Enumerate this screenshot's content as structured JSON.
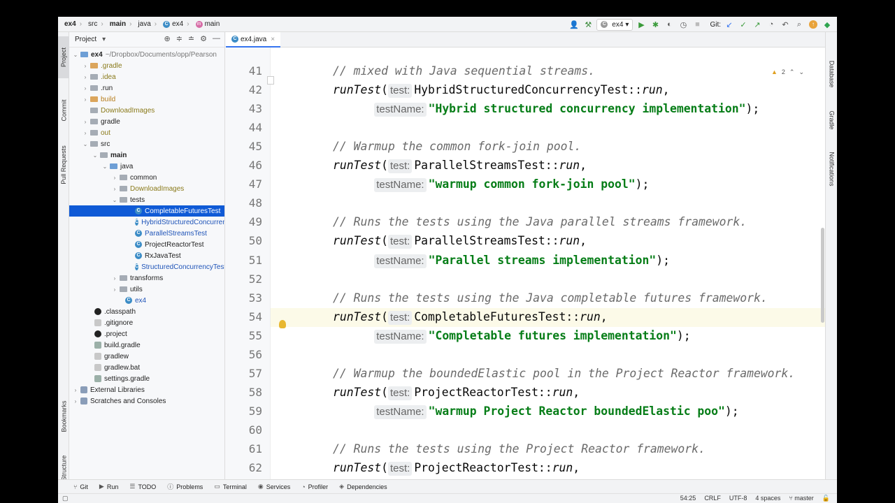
{
  "breadcrumb": [
    "ex4",
    "src",
    "main",
    "java",
    "ex4",
    "main"
  ],
  "toolbar": {
    "run_config": "ex4",
    "git_label": "Git:"
  },
  "left_strip": [
    "Project",
    "Commit",
    "Pull Requests",
    "Bookmarks",
    "Structure"
  ],
  "right_strip": [
    "Database",
    "Gradle",
    "Notifications"
  ],
  "project_panel": {
    "title": "Project",
    "root_label": "ex4",
    "root_path": "~/Dropbox/Documents/opp/Pearson",
    "items": [
      ".gradle",
      ".idea",
      ".run",
      "build",
      "DownloadImages",
      "gradle",
      "out",
      "src",
      "main",
      "java",
      "common",
      "DownloadImages",
      "tests",
      "CompletableFuturesTest",
      "HybridStructuredConcurrencyTest",
      "ParallelStreamsTest",
      "ProjectReactorTest",
      "RxJavaTest",
      "StructuredConcurrencyTest",
      "transforms",
      "utils",
      "ex4",
      ".classpath",
      ".gitignore",
      ".project",
      "build.gradle",
      "gradlew",
      "gradlew.bat",
      "settings.gradle",
      "External Libraries",
      "Scratches and Consoles"
    ]
  },
  "editor": {
    "tab": "ex4.java",
    "warnings": "2",
    "lines": [
      {
        "num": "41",
        "parts": [
          [
            "cm",
            "// mixed with Java sequential streams."
          ]
        ]
      },
      {
        "num": "42",
        "parts": [
          [
            "fn",
            "runTest"
          ],
          [
            "",
            "("
          ],
          [
            "hint",
            "test:"
          ],
          [
            "",
            "HybridStructuredConcurrencyTest::"
          ],
          [
            "fn",
            "run"
          ],
          [
            "",
            ","
          ]
        ]
      },
      {
        "num": "43",
        "indent": "      ",
        "parts": [
          [
            "hint",
            "testName:"
          ],
          [
            "st",
            "\"Hybrid structured concurrency implementation\""
          ],
          [
            "",
            ");"
          ]
        ]
      },
      {
        "num": "44",
        "parts": []
      },
      {
        "num": "45",
        "parts": [
          [
            "cm",
            "// Warmup the common fork-join pool."
          ]
        ]
      },
      {
        "num": "46",
        "parts": [
          [
            "fn",
            "runTest"
          ],
          [
            "",
            "("
          ],
          [
            "hint",
            "test:"
          ],
          [
            "",
            "ParallelStreamsTest::"
          ],
          [
            "fn",
            "run"
          ],
          [
            "",
            ","
          ]
        ]
      },
      {
        "num": "47",
        "indent": "      ",
        "parts": [
          [
            "hint",
            "testName:"
          ],
          [
            "st",
            "\"warmup common fork-join pool\""
          ],
          [
            "",
            ");"
          ]
        ]
      },
      {
        "num": "48",
        "parts": []
      },
      {
        "num": "49",
        "parts": [
          [
            "cm",
            "// Runs the tests using the Java parallel streams framework."
          ]
        ]
      },
      {
        "num": "50",
        "parts": [
          [
            "fn",
            "runTest"
          ],
          [
            "",
            "("
          ],
          [
            "hint",
            "test:"
          ],
          [
            "",
            "ParallelStreamsTest::"
          ],
          [
            "fn",
            "run"
          ],
          [
            "",
            ","
          ]
        ]
      },
      {
        "num": "51",
        "indent": "      ",
        "parts": [
          [
            "hint",
            "testName:"
          ],
          [
            "st",
            "\"Parallel streams implementation\""
          ],
          [
            "",
            ");"
          ]
        ]
      },
      {
        "num": "52",
        "parts": []
      },
      {
        "num": "53",
        "parts": [
          [
            "cm",
            "// Runs the tests using the Java completable futures framework."
          ]
        ]
      },
      {
        "num": "54",
        "parts": [
          [
            "fn",
            "runTest"
          ],
          [
            "",
            "("
          ],
          [
            "hint",
            "test:"
          ],
          [
            "",
            "CompletableFuturesTest::"
          ],
          [
            "fn",
            "run"
          ],
          [
            "",
            ","
          ]
        ]
      },
      {
        "num": "55",
        "indent": "      ",
        "parts": [
          [
            "hint",
            "testName:"
          ],
          [
            "st",
            "\"Completable futures implementation\""
          ],
          [
            "",
            ");"
          ]
        ]
      },
      {
        "num": "56",
        "parts": []
      },
      {
        "num": "57",
        "parts": [
          [
            "cm",
            "// Warmup the boundedElastic pool in the Project Reactor framework."
          ]
        ]
      },
      {
        "num": "58",
        "parts": [
          [
            "fn",
            "runTest"
          ],
          [
            "",
            "("
          ],
          [
            "hint",
            "test:"
          ],
          [
            "",
            "ProjectReactorTest::"
          ],
          [
            "fn",
            "run"
          ],
          [
            "",
            ","
          ]
        ]
      },
      {
        "num": "59",
        "indent": "      ",
        "parts": [
          [
            "hint",
            "testName:"
          ],
          [
            "st",
            "\"warmup Project Reactor boundedElastic poo\""
          ],
          [
            "",
            ");"
          ]
        ]
      },
      {
        "num": "60",
        "parts": []
      },
      {
        "num": "61",
        "parts": [
          [
            "cm",
            "// Runs the tests using the Project Reactor framework."
          ]
        ]
      },
      {
        "num": "62",
        "parts": [
          [
            "fn",
            "runTest"
          ],
          [
            "",
            "("
          ],
          [
            "hint",
            "test:"
          ],
          [
            "",
            "ProjectReactorTest::"
          ],
          [
            "fn",
            "run"
          ],
          [
            "",
            ","
          ]
        ]
      }
    ]
  },
  "tool_windows": [
    "Git",
    "Run",
    "TODO",
    "Problems",
    "Terminal",
    "Services",
    "Profiler",
    "Dependencies"
  ],
  "status_bar": {
    "position": "54:25",
    "line_sep": "CRLF",
    "encoding": "UTF-8",
    "indent": "4 spaces",
    "branch": "master"
  }
}
